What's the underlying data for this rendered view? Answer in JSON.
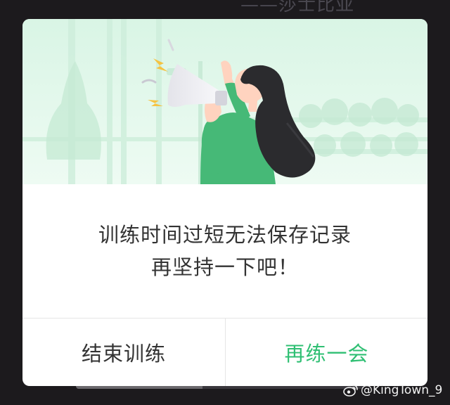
{
  "background": {
    "quote_text": "——莎士比亚",
    "progress_fraction": 0.44
  },
  "dialog": {
    "illustration_name": "woman-with-megaphone",
    "message_line1": "训练时间过短无法保存记录",
    "message_line2": "再坚持一下吧！",
    "end_button_label": "结束训练",
    "continue_button_label": "再练一会"
  },
  "watermark": {
    "icon": "weibo-icon",
    "text": "@KingTown_9"
  },
  "colors": {
    "accent_green": "#2fbf73",
    "text_dark": "#333333",
    "overlay": "#1c1a1d"
  }
}
